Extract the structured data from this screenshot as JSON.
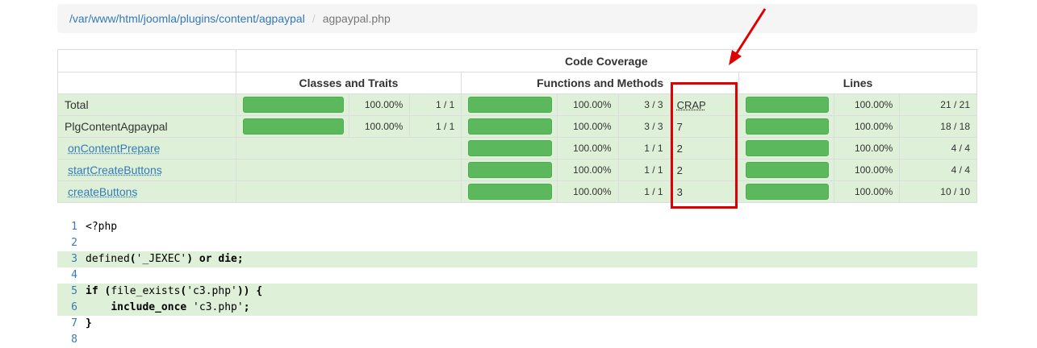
{
  "breadcrumb": {
    "path_link": "/var/www/html/joomla/plugins/content/agpaypal",
    "separator": "/",
    "current": "agpaypal.php"
  },
  "coverage": {
    "title": "Code Coverage",
    "groups": {
      "classes": "Classes and Traits",
      "functions": "Functions and Methods",
      "lines": "Lines"
    },
    "rows": [
      {
        "name": "Total",
        "link": false,
        "classes": {
          "bar": 1.0,
          "pct": "100.00%",
          "frac": "1 / 1"
        },
        "functions": {
          "bar": 1.0,
          "pct": "100.00%",
          "frac": "3 / 3"
        },
        "crap": "CRAP",
        "lines": {
          "bar": 1.0,
          "pct": "100.00%",
          "frac": "21 / 21"
        }
      },
      {
        "name": "PlgContentAgpaypal",
        "link": false,
        "classes": {
          "bar": 1.0,
          "pct": "100.00%",
          "frac": "1 / 1"
        },
        "functions": {
          "bar": 1.0,
          "pct": "100.00%",
          "frac": "3 / 3"
        },
        "crap": "7",
        "lines": {
          "bar": 1.0,
          "pct": "100.00%",
          "frac": "18 / 18"
        }
      },
      {
        "name": "onContentPrepare",
        "link": true,
        "functions": {
          "bar": 1.0,
          "pct": "100.00%",
          "frac": "1 / 1"
        },
        "crap": "2",
        "lines": {
          "bar": 1.0,
          "pct": "100.00%",
          "frac": "4 / 4"
        }
      },
      {
        "name": "startCreateButtons",
        "link": true,
        "functions": {
          "bar": 1.0,
          "pct": "100.00%",
          "frac": "1 / 1"
        },
        "crap": "2",
        "lines": {
          "bar": 1.0,
          "pct": "100.00%",
          "frac": "4 / 4"
        }
      },
      {
        "name": "createButtons",
        "link": true,
        "functions": {
          "bar": 1.0,
          "pct": "100.00%",
          "frac": "1 / 1"
        },
        "crap": "3",
        "lines": {
          "bar": 1.0,
          "pct": "100.00%",
          "frac": "10 / 10"
        }
      }
    ]
  },
  "code": {
    "lines": [
      {
        "n": "1",
        "covered": false,
        "parts": [
          {
            "t": "<?php"
          }
        ]
      },
      {
        "n": "2",
        "covered": false,
        "parts": []
      },
      {
        "n": "3",
        "covered": true,
        "parts": [
          {
            "t": "defined"
          },
          {
            "t": "(",
            "b": true
          },
          {
            "t": "'_JEXEC'"
          },
          {
            "t": ")",
            "b": true
          },
          {
            "t": " "
          },
          {
            "t": "or",
            "b": true
          },
          {
            "t": " "
          },
          {
            "t": "die;",
            "b": true
          }
        ]
      },
      {
        "n": "4",
        "covered": false,
        "parts": []
      },
      {
        "n": "5",
        "covered": true,
        "parts": [
          {
            "t": "if",
            "b": true
          },
          {
            "t": " "
          },
          {
            "t": "(",
            "b": true
          },
          {
            "t": "file_exists"
          },
          {
            "t": "(",
            "b": true
          },
          {
            "t": "'c3.php'"
          },
          {
            "t": "))",
            "b": true
          },
          {
            "t": " "
          },
          {
            "t": "{",
            "b": true
          }
        ]
      },
      {
        "n": "6",
        "covered": true,
        "parts": [
          {
            "t": "    "
          },
          {
            "t": "include_once",
            "b": true
          },
          {
            "t": " 'c3.php'"
          },
          {
            "t": ";",
            "b": true
          }
        ]
      },
      {
        "n": "7",
        "covered": false,
        "parts": [
          {
            "t": "}",
            "b": true
          }
        ]
      },
      {
        "n": "8",
        "covered": false,
        "parts": []
      }
    ]
  },
  "colors": {
    "covered_row": "#dff0d8",
    "bar": "#5cb85c",
    "link": "#337ab7",
    "annotation": "#e00000"
  }
}
